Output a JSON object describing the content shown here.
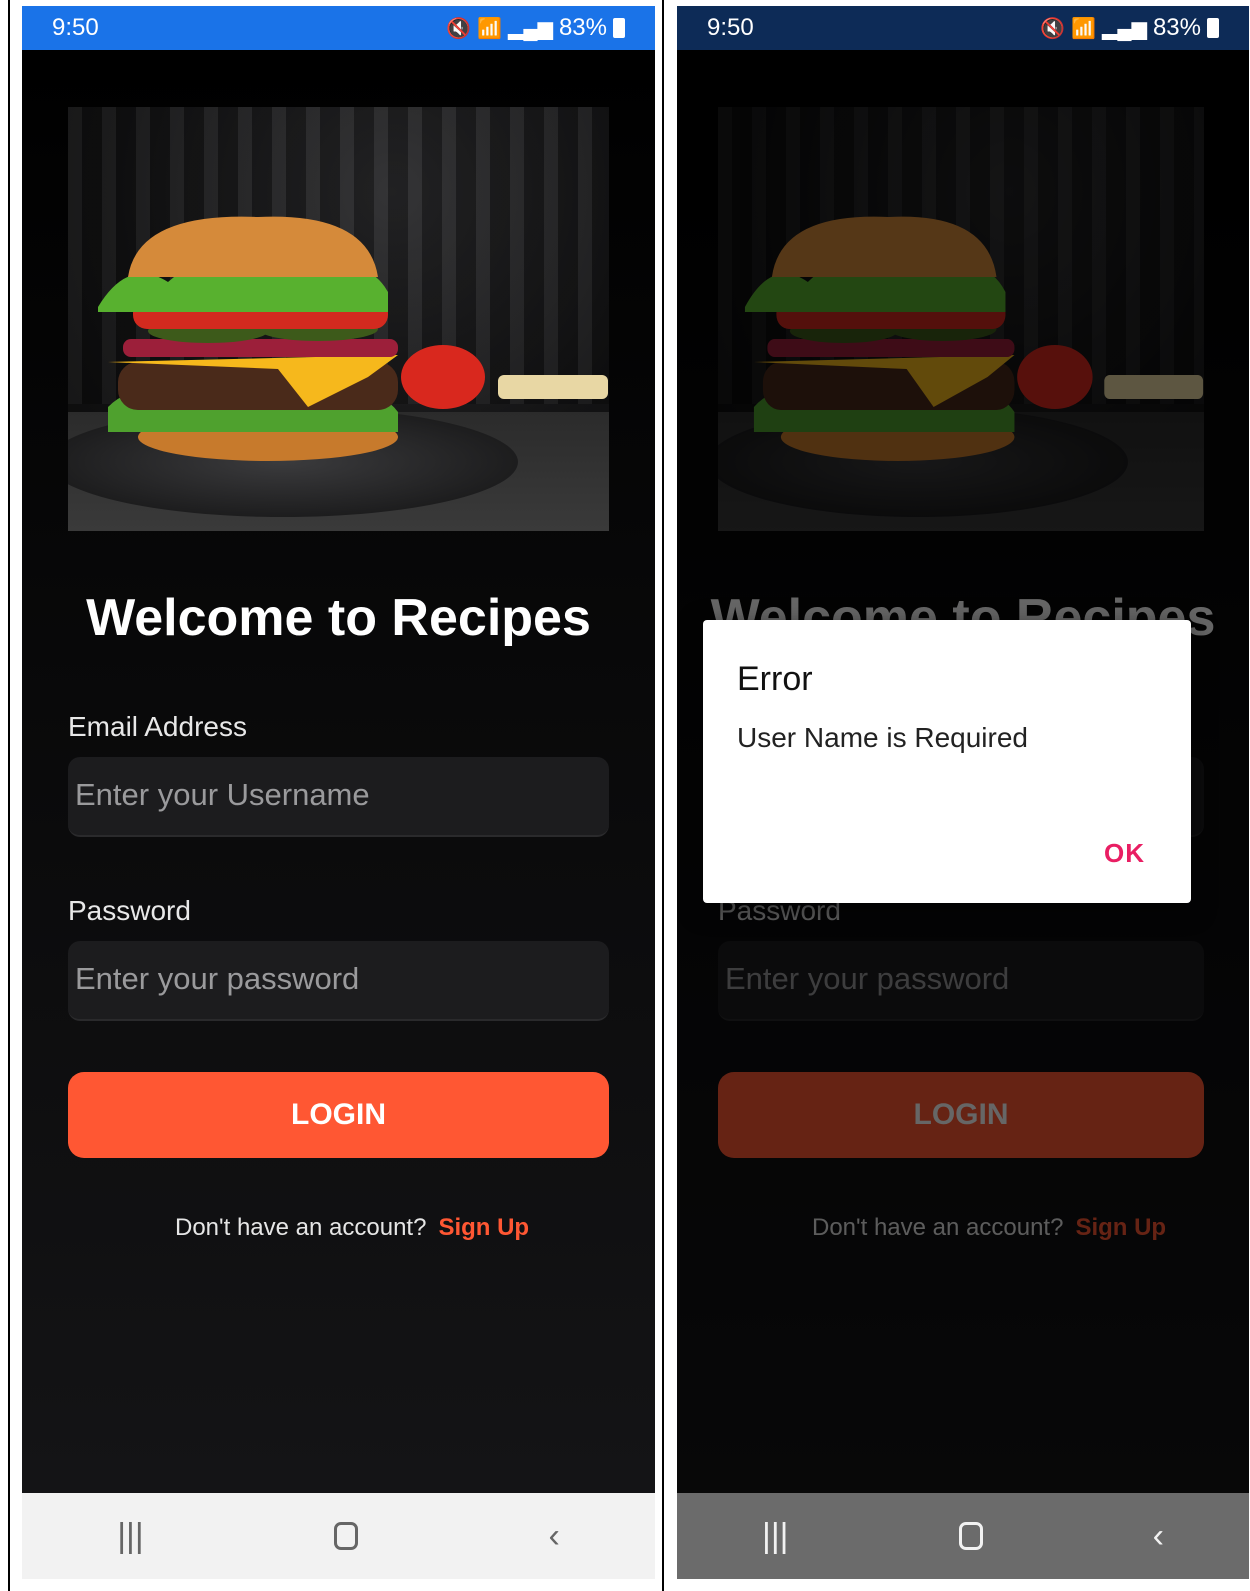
{
  "statusbar": {
    "time": "9:50",
    "battery": "83%",
    "icons": [
      "mute-icon",
      "wifi-icon",
      "volte-icon",
      "signal-icon",
      "signal-icon",
      "battery-icon"
    ]
  },
  "login": {
    "title": "Welcome to Recipes",
    "email_label": "Email Address",
    "email_placeholder": "Enter your Username",
    "password_label": "Password",
    "password_placeholder": "Enter your password",
    "login_button": "LOGIN",
    "footer_text": "Don't have an account?",
    "signup_link": "Sign Up"
  },
  "dialog": {
    "title": "Error",
    "message": "User Name is Required",
    "ok": "OK"
  },
  "navbar": {
    "recents_icon": "recents-icon",
    "home_icon": "home-icon",
    "back_icon": "back-icon"
  },
  "colors": {
    "accent": "#ff5733",
    "background": "#0d0d0e",
    "dialog_ok": "#e91e63",
    "statusbar_left": "#1a73e8",
    "statusbar_right": "#0d2b57"
  }
}
